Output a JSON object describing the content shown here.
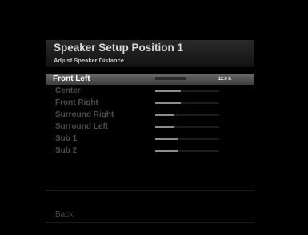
{
  "header": {
    "title": "Speaker Setup Position 1",
    "subtitle": "Adjust Speaker Distance"
  },
  "speakers": [
    {
      "label": "Front Left",
      "selected": true,
      "level": 0.35,
      "value": "12.0 ft"
    },
    {
      "label": "Center",
      "selected": false,
      "level": 0.4,
      "value": ""
    },
    {
      "label": "Front Right",
      "selected": false,
      "level": 0.4,
      "value": ""
    },
    {
      "label": "Surround Right",
      "selected": false,
      "level": 0.3,
      "value": ""
    },
    {
      "label": "Surround Left",
      "selected": false,
      "level": 0.3,
      "value": ""
    },
    {
      "label": "Sub 1",
      "selected": false,
      "level": 0.35,
      "value": ""
    },
    {
      "label": "Sub 2",
      "selected": false,
      "level": 0.35,
      "value": ""
    }
  ],
  "footer": {
    "back_label": "Back"
  },
  "colors": {
    "background": "#000000",
    "selected_row": "#5a5a5a",
    "title_text": "#d8d8d8",
    "dim_text": "#4e4e4e"
  }
}
